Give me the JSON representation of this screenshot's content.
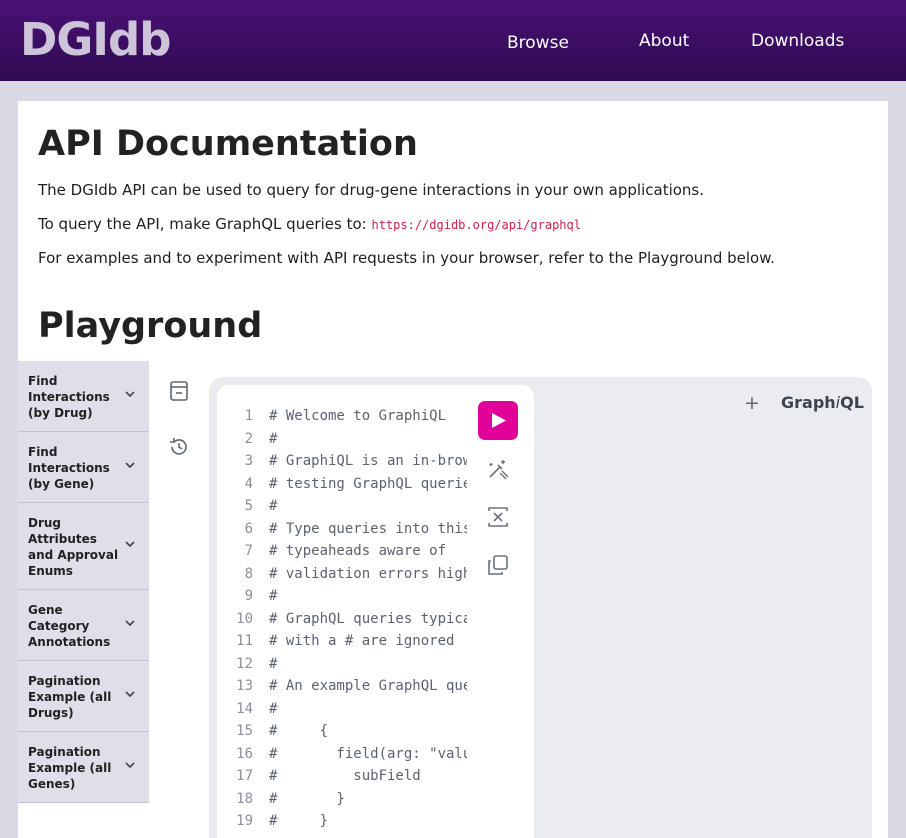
{
  "nav": {
    "logo": "DGIdb",
    "links": [
      "Browse",
      "About",
      "Downloads"
    ]
  },
  "doc": {
    "title": "API Documentation",
    "intro": "The DGIdb API can be used to query for drug-gene interactions in your own applications.",
    "query_prefix": "To query the API, make GraphQL queries to: ",
    "endpoint": "https://dgidb.org/api/graphql",
    "examples_text": "For examples and to experiment with API requests in your browser, refer to the Playground below."
  },
  "playground": {
    "title": "Playground",
    "examples": [
      "Find Interactions (by Drug)",
      "Find Interactions (by Gene)",
      "Drug Attributes and Approval Enums",
      "Gene Category Annotations",
      "Pagination Example (all Drugs)",
      "Pagination Example (all Genes)"
    ]
  },
  "graphiql": {
    "brand_prefix": "Graph",
    "brand_italic": "i",
    "brand_suffix": "QL",
    "add_tab": "+",
    "lines": [
      {
        "n": "1",
        "t": "# Welcome to GraphiQL"
      },
      {
        "n": "2",
        "t": "#"
      },
      {
        "n": "3",
        "t": "# GraphiQL is an in-browser"
      },
      {
        "n": "4",
        "t": "# testing GraphQL queries"
      },
      {
        "n": "5",
        "t": "#"
      },
      {
        "n": "6",
        "t": "# Type queries into this"
      },
      {
        "n": "7",
        "t": "# typeaheads aware of"
      },
      {
        "n": "8",
        "t": "# validation errors highlighted"
      },
      {
        "n": "9",
        "t": "#"
      },
      {
        "n": "10",
        "t": "# GraphQL queries typically"
      },
      {
        "n": "11",
        "t": "# with a # are ignored"
      },
      {
        "n": "12",
        "t": "#"
      },
      {
        "n": "13",
        "t": "# An example GraphQL query"
      },
      {
        "n": "14",
        "t": "#"
      },
      {
        "n": "15",
        "t": "#     {"
      },
      {
        "n": "16",
        "t": "#       field(arg: \"value\")"
      },
      {
        "n": "17",
        "t": "#         subField"
      },
      {
        "n": "18",
        "t": "#       }"
      },
      {
        "n": "19",
        "t": "#     }"
      }
    ],
    "icons": {
      "history_panel": "document-icon",
      "history": "history-icon",
      "run": "play-icon",
      "prettify": "prettify-icon",
      "merge": "merge-fragments-icon",
      "copy": "copy-icon"
    },
    "colors": {
      "run": "#e10098",
      "nav": "#3d0e63"
    }
  }
}
